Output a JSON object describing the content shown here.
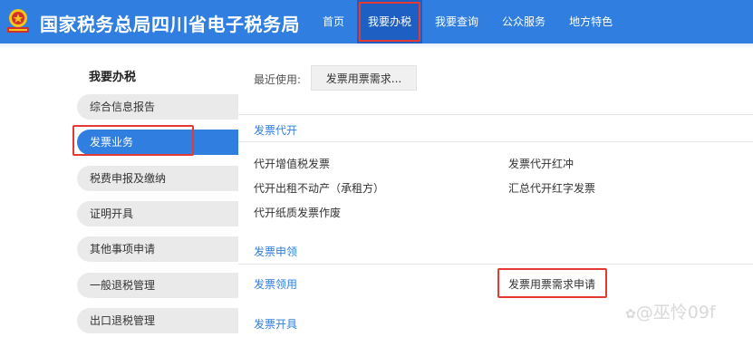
{
  "header": {
    "title": "国家税务总局四川省电子税务局",
    "nav": [
      {
        "label": "首页",
        "name": "nav-home",
        "active": false
      },
      {
        "label": "我要办税",
        "name": "nav-tax-handling",
        "active": true
      },
      {
        "label": "我要查询",
        "name": "nav-query",
        "active": false
      },
      {
        "label": "公众服务",
        "name": "nav-public-service",
        "active": false
      },
      {
        "label": "地方特色",
        "name": "nav-local-features",
        "active": false
      }
    ]
  },
  "sidebar": {
    "heading": "我要办税",
    "items": [
      {
        "label": "综合信息报告",
        "name": "sidebar-item-info-report"
      },
      {
        "label": "发票业务",
        "name": "sidebar-item-invoice",
        "active": true
      },
      {
        "label": "税费申报及缴纳",
        "name": "sidebar-item-tax-filing"
      },
      {
        "label": "证明开具",
        "name": "sidebar-item-certificate"
      },
      {
        "label": "其他事项申请",
        "name": "sidebar-item-other-apply"
      },
      {
        "label": "一般退税管理",
        "name": "sidebar-item-refund"
      },
      {
        "label": "出口退税管理",
        "name": "sidebar-item-export-refund"
      }
    ]
  },
  "main": {
    "recent_label": "最近使用:",
    "recent_chip": "发票用票需求...",
    "sections": {
      "daikai": {
        "title": "发票代开",
        "links": [
          "代开增值税发票",
          "发票代开红冲",
          "代开出租不动产（承租方）",
          "汇总代开红字发票",
          "代开纸质发票作废"
        ]
      },
      "shenling": {
        "title": "发票申领",
        "links": [
          "发票领用",
          "发票用票需求申请"
        ]
      },
      "kaiju": {
        "title": "发票开具"
      }
    }
  },
  "watermark": {
    "icon": "✿",
    "text": "@巫怜09f"
  },
  "colors": {
    "brand": "#2f7ee0",
    "highlight": "#e53935",
    "sidebar_bg": "#eaeaea"
  }
}
